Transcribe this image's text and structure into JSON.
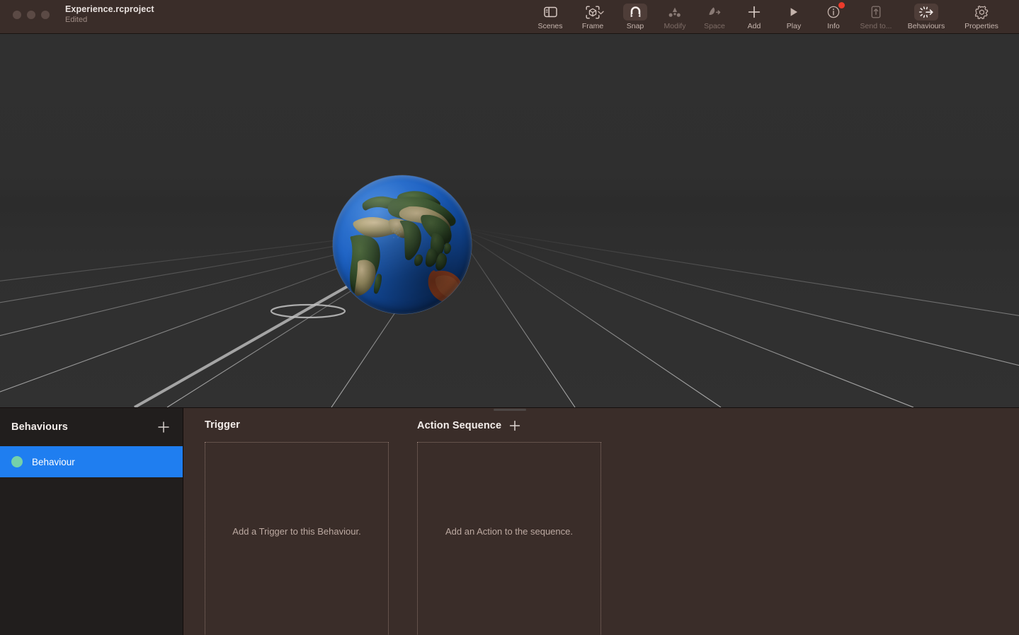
{
  "window": {
    "title": "Experience.rcproject",
    "subtitle": "Edited",
    "traffic_lights": [
      "close",
      "minimize",
      "zoom"
    ]
  },
  "toolbar": {
    "items": [
      {
        "id": "scenes",
        "label": "Scenes",
        "icon": "sidebar-panel-icon",
        "active": false,
        "dim": false,
        "badge": false,
        "chevron": false
      },
      {
        "id": "frame",
        "label": "Frame",
        "icon": "frame-cube-icon",
        "active": false,
        "dim": false,
        "badge": false,
        "chevron": true
      },
      {
        "id": "snap",
        "label": "Snap",
        "icon": "magnet-icon",
        "active": true,
        "dim": false,
        "badge": false,
        "chevron": false
      },
      {
        "id": "modify",
        "label": "Modify",
        "icon": "modify-icon",
        "active": false,
        "dim": true,
        "badge": false,
        "chevron": false
      },
      {
        "id": "space",
        "label": "Space",
        "icon": "space-icon",
        "active": false,
        "dim": true,
        "badge": false,
        "chevron": false
      },
      {
        "id": "add",
        "label": "Add",
        "icon": "plus-icon",
        "active": false,
        "dim": false,
        "badge": false,
        "chevron": false
      },
      {
        "id": "play",
        "label": "Play",
        "icon": "play-triangle-icon",
        "active": false,
        "dim": false,
        "badge": false,
        "chevron": false
      },
      {
        "id": "info",
        "label": "Info",
        "icon": "info-circle-icon",
        "active": false,
        "dim": false,
        "badge": true,
        "chevron": false
      },
      {
        "id": "send-to",
        "label": "Send to...",
        "icon": "export-upload-icon",
        "active": false,
        "dim": true,
        "badge": false,
        "chevron": false
      },
      {
        "id": "behaviours",
        "label": "Behaviours",
        "icon": "behaviours-burst-icon",
        "active": true,
        "dim": false,
        "badge": false,
        "chevron": false
      },
      {
        "id": "properties",
        "label": "Properties",
        "icon": "gear-cube-icon",
        "active": false,
        "dim": false,
        "badge": false,
        "chevron": false
      }
    ]
  },
  "viewport": {
    "scene_object": "earth-globe",
    "grid": "perspective-floor-grid"
  },
  "behaviours_panel": {
    "title": "Behaviours",
    "add_label": "+",
    "items": [
      {
        "name": "Behaviour",
        "selected": true,
        "dot_color": "#74d1aa"
      }
    ]
  },
  "editor": {
    "trigger": {
      "title": "Trigger",
      "has_add": false,
      "placeholder": "Add a Trigger to this Behaviour."
    },
    "action_sequence": {
      "title": "Action Sequence",
      "has_add": true,
      "add_label": "+",
      "placeholder": "Add an Action to the sequence."
    }
  },
  "colors": {
    "titlebar_bg": "#3a2d29",
    "editor_bg": "#3a2d29",
    "sidebar_bg": "#211e1d",
    "selection_blue": "#1f7ef0",
    "behaviour_dot": "#74d1aa",
    "badge_red": "#ec3b2b",
    "viewport_bg": "#2e2e2e",
    "dropzone_border": "#8b756c"
  }
}
